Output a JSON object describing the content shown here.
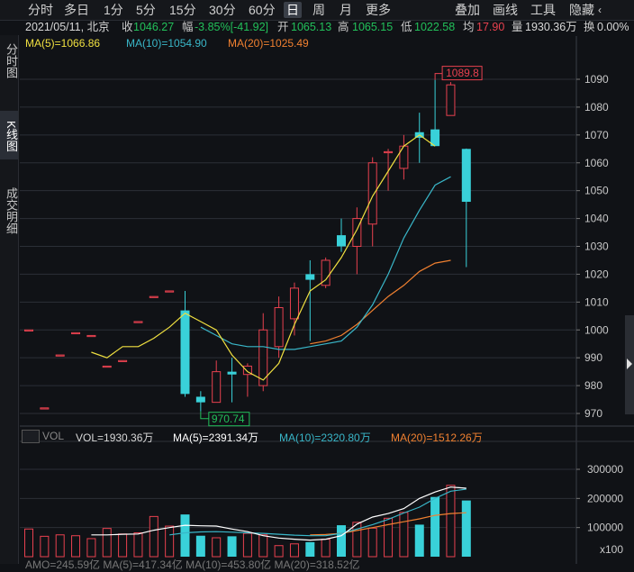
{
  "toolbar": {
    "left_items": [
      "分时",
      "多日",
      "1分",
      "5分",
      "15分",
      "30分",
      "60分",
      "日",
      "周",
      "月",
      "更多"
    ],
    "active": "日",
    "right_items": [
      "叠加",
      "画线",
      "工具",
      "隐藏"
    ],
    "hide_arrow": "‹",
    "percent": "0.00%"
  },
  "info": {
    "date_place": "2021/05/11, 北京",
    "close_label": "收",
    "close_value": "1046.27",
    "range_label": "幅",
    "range_value": "-3.85%[-41.92]",
    "open_label": "开",
    "open_value": "1065.13",
    "high_label": "高",
    "high_value": "1065.15",
    "low_label": "低",
    "low_value": "1022.58",
    "avg_label": "均",
    "avg_value": "17.90",
    "vol_label": "量",
    "vol_value": "1930.36万",
    "turn_label": "换",
    "turn_value": "0.00%"
  },
  "sidebar": {
    "tabs": [
      {
        "label": "分时图",
        "active": false
      },
      {
        "label": "K线图",
        "active": true
      },
      {
        "label": "成交明细",
        "active": false
      }
    ]
  },
  "legend": {
    "ma5": "MA(5)=1066.86",
    "ma10": "MA(10)=1054.90",
    "ma20": "MA(20)=1025.49"
  },
  "vol_legend": {
    "vol": "VOL=1930.36万",
    "ma5": "MA(5)=2391.34万",
    "ma10": "MA(10)=2320.80万",
    "ma20": "MA(20)=1512.26万",
    "tag": "VOL"
  },
  "amo_legend": {
    "text": "AMO=245.59亿     MA(5)=417.34亿     MA(10)=453.80亿     MA(20)=318.52亿"
  },
  "annotations": {
    "high": "1089.8",
    "low": "970.74"
  },
  "colors": {
    "up": "#e8414f",
    "down": "#39d1d9",
    "ma5": "#f0e040",
    "ma10": "#39b6c8",
    "ma20": "#f08030",
    "vol_ma5": "#ffffff",
    "grid": "#2b2f36"
  },
  "price_axis": {
    "ticks": [
      "1090",
      "1080",
      "1070",
      "1060",
      "1050",
      "1040",
      "1030",
      "1020",
      "1010",
      "1000",
      "990",
      "980",
      "970"
    ]
  },
  "vol_axis": {
    "ticks": [
      "300000",
      "200000",
      "100000"
    ],
    "unit": "x100"
  },
  "chart_data": {
    "type": "candlestick",
    "price_range": [
      965,
      1100
    ],
    "candles": [
      {
        "o": 1000,
        "c": 1000,
        "h": 1000,
        "l": 1000
      },
      {
        "o": 972,
        "c": 972,
        "h": 972,
        "l": 972
      },
      {
        "o": 991,
        "c": 991,
        "h": 991,
        "l": 991
      },
      {
        "o": 999,
        "c": 999,
        "h": 999,
        "l": 999
      },
      {
        "o": 998,
        "c": 998,
        "h": 998,
        "l": 998
      },
      {
        "o": 987,
        "c": 987,
        "h": 987,
        "l": 987
      },
      {
        "o": 989,
        "c": 989,
        "h": 989,
        "l": 989
      },
      {
        "o": 1003,
        "c": 1003,
        "h": 1003,
        "l": 1003
      },
      {
        "o": 1012,
        "c": 1012,
        "h": 1012,
        "l": 1012
      },
      {
        "o": 1014,
        "c": 1014,
        "h": 1014,
        "l": 1014
      },
      {
        "o": 1007,
        "c": 977,
        "h": 1014,
        "l": 976
      },
      {
        "o": 976,
        "c": 974,
        "h": 978,
        "l": 970.74
      },
      {
        "o": 974,
        "c": 985,
        "h": 989,
        "l": 974
      },
      {
        "o": 985,
        "c": 984,
        "h": 990,
        "l": 974
      },
      {
        "o": 984,
        "c": 987,
        "h": 988,
        "l": 976
      },
      {
        "o": 980,
        "c": 1000,
        "h": 1006,
        "l": 978
      },
      {
        "o": 994,
        "c": 1008,
        "h": 1012,
        "l": 990
      },
      {
        "o": 1004,
        "c": 1015,
        "h": 1017,
        "l": 998
      },
      {
        "o": 1020,
        "c": 1018,
        "h": 1025,
        "l": 996
      },
      {
        "o": 1016,
        "c": 1025,
        "h": 1026,
        "l": 1015
      },
      {
        "o": 1034,
        "c": 1030,
        "h": 1040,
        "l": 1028
      },
      {
        "o": 1030,
        "c": 1040,
        "h": 1044,
        "l": 1020
      },
      {
        "o": 1038,
        "c": 1060,
        "h": 1062,
        "l": 1030
      },
      {
        "o": 1064,
        "c": 1064,
        "h": 1065,
        "l": 1050
      },
      {
        "o": 1058,
        "c": 1066,
        "h": 1070,
        "l": 1054
      },
      {
        "o": 1071,
        "c": 1069,
        "h": 1078,
        "l": 1060
      },
      {
        "o": 1072,
        "c": 1066,
        "h": 1089.8,
        "l": 1066
      },
      {
        "o": 1077,
        "c": 1088,
        "h": 1089,
        "l": 1077
      },
      {
        "o": 1065,
        "c": 1046,
        "h": 1065.15,
        "l": 1022.58
      }
    ],
    "ma5": [
      null,
      null,
      null,
      null,
      992,
      990,
      994,
      994,
      997,
      1001,
      1006,
      1003,
      1000,
      991,
      985,
      982,
      988,
      1002,
      1014,
      1018,
      1026,
      1036,
      1048,
      1057,
      1066,
      1070,
      1066
    ],
    "ma10": [
      null,
      null,
      null,
      null,
      null,
      null,
      null,
      null,
      null,
      null,
      null,
      1001,
      998,
      995,
      994,
      994,
      993,
      993,
      994,
      995,
      996,
      1001,
      1009,
      1020,
      1033,
      1043,
      1052,
      1055
    ],
    "ma20": [
      null,
      null,
      null,
      null,
      null,
      null,
      null,
      null,
      null,
      null,
      null,
      null,
      null,
      null,
      null,
      null,
      null,
      null,
      995,
      996,
      998,
      1002,
      1007,
      1012,
      1016,
      1021,
      1024,
      1025
    ],
    "volume_range": [
      0,
      330000
    ],
    "volume": [
      95000,
      70000,
      75000,
      72000,
      62000,
      97000,
      78000,
      82000,
      138000,
      105000,
      145000,
      72000,
      65000,
      70000,
      80000,
      75000,
      38000,
      44000,
      50000,
      60000,
      108000,
      118000,
      98000,
      132000,
      152000,
      110000,
      205000,
      245000,
      193000
    ],
    "vol_ma5": [
      null,
      null,
      null,
      null,
      75000,
      75000,
      77000,
      78000,
      91000,
      100000,
      108000,
      106000,
      105000,
      95000,
      86000,
      72000,
      64000,
      60000,
      57000,
      60000,
      72000,
      112000,
      136000,
      148000,
      165000,
      200000,
      222000,
      239000,
      235000
    ],
    "vol_ma10": [
      null,
      null,
      null,
      null,
      null,
      null,
      null,
      null,
      null,
      75000,
      82000,
      85000,
      86000,
      84000,
      82000,
      80000,
      77000,
      74000,
      72000,
      72000,
      80000,
      95000,
      110000,
      128000,
      150000,
      170000,
      200000,
      225000,
      232000
    ],
    "vol_ma20": [
      null,
      null,
      null,
      null,
      null,
      null,
      null,
      null,
      null,
      null,
      null,
      null,
      null,
      null,
      null,
      null,
      null,
      null,
      75000,
      76000,
      80000,
      90000,
      100000,
      110000,
      120000,
      130000,
      142000,
      148000,
      151000
    ]
  }
}
